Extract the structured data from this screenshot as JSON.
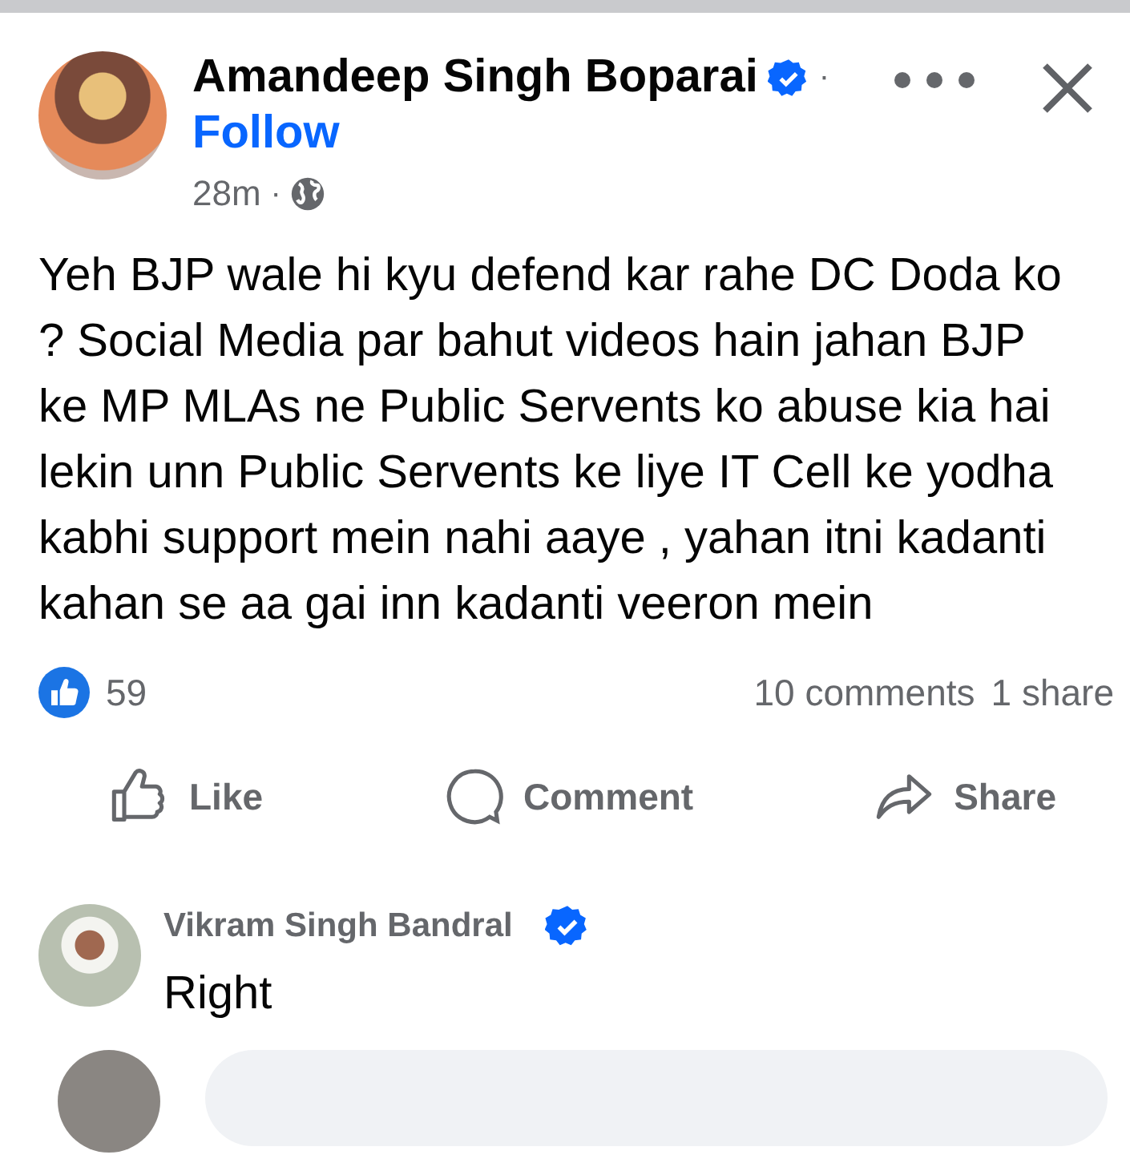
{
  "post": {
    "author": "Amandeep Singh Boparai",
    "verified": true,
    "separator": "·",
    "follow": "Follow",
    "time": "28m",
    "time_separator": "·",
    "text": "Yeh BJP wale hi kyu defend kar rahe DC Doda ko ? Social Media par bahut videos hain jahan BJP ke MP MLAs ne Public Servents ko abuse kia hai lekin unn Public Servents ke liye IT Cell ke yodha kabhi support mein nahi aaye , yahan itni kadanti kahan se aa gai inn kadanti veeron mein"
  },
  "reactions": {
    "count": "59",
    "comments": "10 comments",
    "shares": "1 share"
  },
  "actions": [
    {
      "kind": "like",
      "label": "Like"
    },
    {
      "kind": "comment",
      "label": "Comment"
    },
    {
      "kind": "share",
      "label": "Share"
    }
  ],
  "comments": [
    {
      "author": "Vikram Singh Bandral",
      "verified": true,
      "text": "Right"
    }
  ]
}
